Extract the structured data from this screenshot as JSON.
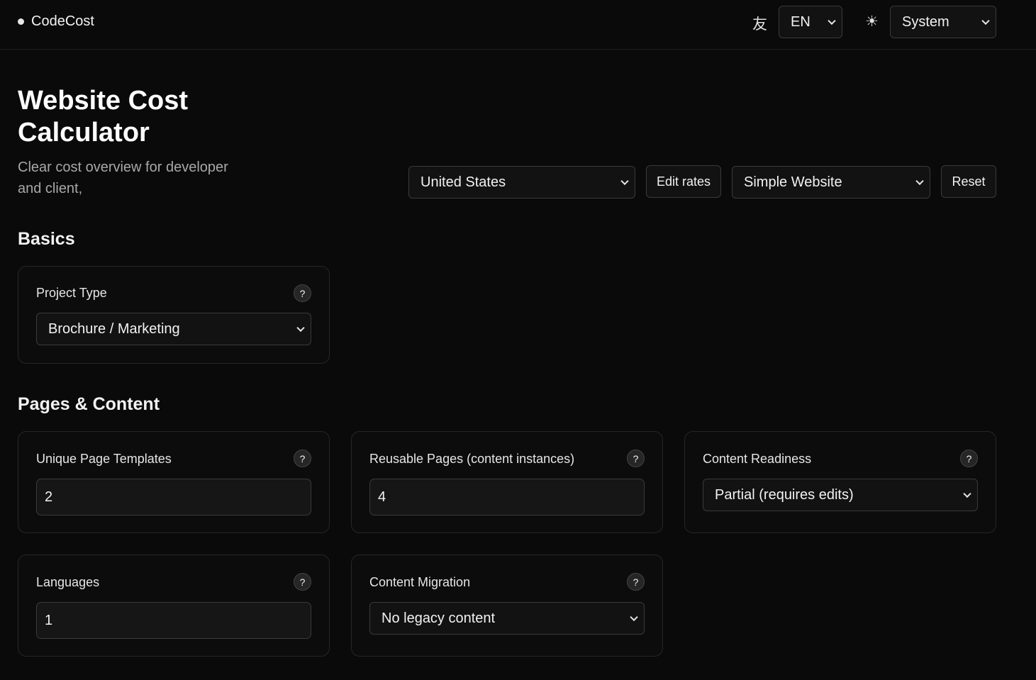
{
  "header": {
    "brand": "CodeCost",
    "language_icon": "友",
    "language_value": "EN",
    "theme_icon": "☀",
    "theme_value": "System"
  },
  "hero": {
    "title": "Website Cost Calculator",
    "subtitle": "Clear cost overview for developer and client,"
  },
  "toolbar": {
    "country": "United States",
    "edit_rates": "Edit rates",
    "preset": "Simple Website",
    "reset": "Reset"
  },
  "sections": {
    "basics": "Basics",
    "pages_content": "Pages & Content"
  },
  "fields": {
    "project_type": {
      "label": "Project Type",
      "value": "Brochure / Marketing"
    },
    "unique_templates": {
      "label": "Unique Page Templates",
      "value": "2"
    },
    "reusable_pages": {
      "label": "Reusable Pages (content instances)",
      "value": "4"
    },
    "content_readiness": {
      "label": "Content Readiness",
      "value": "Partial (requires edits)"
    },
    "languages": {
      "label": "Languages",
      "value": "1"
    },
    "content_migration": {
      "label": "Content Migration",
      "value": "No legacy content"
    }
  },
  "help_glyph": "?"
}
